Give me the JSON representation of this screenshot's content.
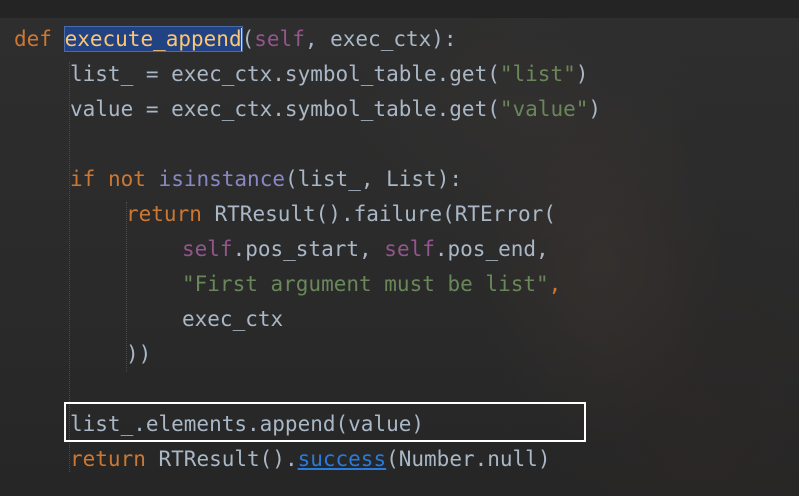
{
  "code": {
    "l1": {
      "kw_def": "def",
      "fn_name": "execute_append",
      "p_open": "(",
      "self": "self",
      "rest": ", exec_ctx):"
    },
    "l2": {
      "pre": "list_ = exec_ctx.symbol_table.get(",
      "str": "\"list\"",
      "post": ")"
    },
    "l3": {
      "pre": "value = exec_ctx.symbol_table.get(",
      "str": "\"value\"",
      "post": ")"
    },
    "l5": {
      "kw_if": "if",
      "kw_not": "not",
      "builtin": "isinstance",
      "rest": "(list_, List):"
    },
    "l6": {
      "kw_return": "return",
      "rest": "RTResult().failure(RTError("
    },
    "l7": {
      "self1": "self",
      "mid": ".pos_start, ",
      "self2": "self",
      "end": ".pos_end,"
    },
    "l8": {
      "str": "\"First argument must be list\"",
      "comma": ","
    },
    "l9": {
      "text": "exec_ctx"
    },
    "l10": {
      "text": "))"
    },
    "l12": {
      "text": "list_.elements.append(value)"
    },
    "l13": {
      "kw_return": "return",
      "pre": "RTResult().",
      "link": "success",
      "post": "(Number.null)"
    }
  },
  "colors": {
    "keyword": "#cc7832",
    "function": "#ffc66d",
    "self": "#94558d",
    "string": "#6a8759",
    "builtin": "#8888c6",
    "text": "#a9b7c6",
    "selection": "#214283",
    "highlight_box": "#ffffff"
  }
}
